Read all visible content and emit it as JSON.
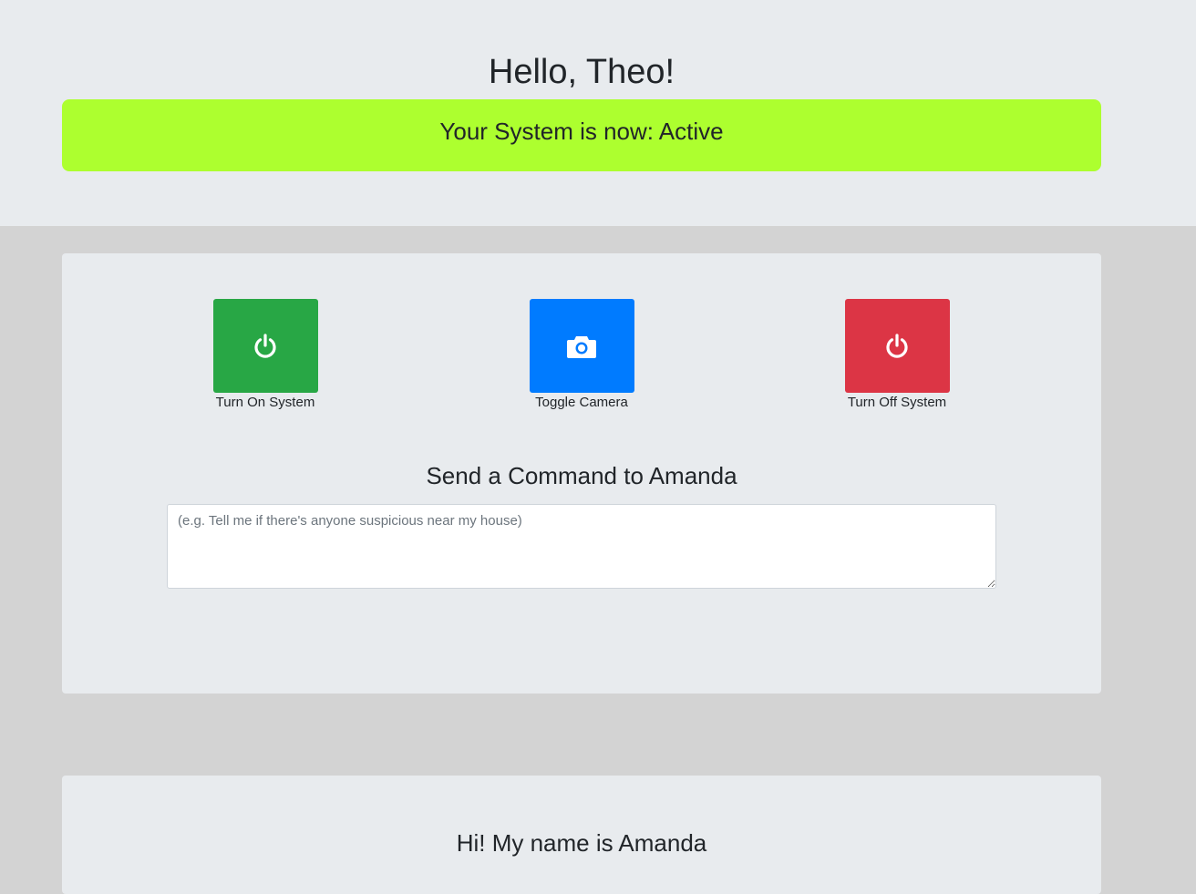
{
  "header": {
    "greeting": "Hello, Theo!",
    "status_text": "Your System is now: Active",
    "status_color": "#adff2f"
  },
  "controls": [
    {
      "label": "Turn On System",
      "icon": "power-icon",
      "color": "#28a745"
    },
    {
      "label": "Toggle Camera",
      "icon": "camera-icon",
      "color": "#007bff"
    },
    {
      "label": "Turn Off System",
      "icon": "power-icon",
      "color": "#dc3545"
    }
  ],
  "command": {
    "title": "Send a Command to Amanda",
    "placeholder": "(e.g. Tell me if there's anyone suspicious near my house)",
    "value": ""
  },
  "intro": {
    "title": "Hi! My name is Amanda"
  }
}
